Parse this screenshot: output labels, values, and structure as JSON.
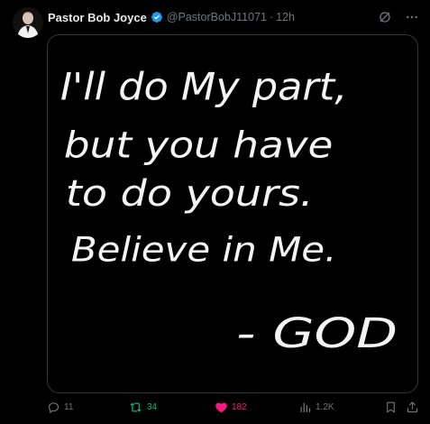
{
  "tweet": {
    "author_name": "Pastor Bob Joyce",
    "handle": "@PastorBobJ11071",
    "separator": "·",
    "time": "12h"
  },
  "media": {
    "lines": [
      "I'll do My part,",
      "but you have",
      "to do yours.",
      "Believe in Me."
    ],
    "signature": "- GOD"
  },
  "actions": {
    "replies": "11",
    "reposts": "34",
    "likes": "182",
    "views": "1.2K"
  },
  "colors": {
    "verified": "#1d9bf0",
    "repost": "#00ba7c",
    "like": "#f91880",
    "muted": "#71767b"
  }
}
